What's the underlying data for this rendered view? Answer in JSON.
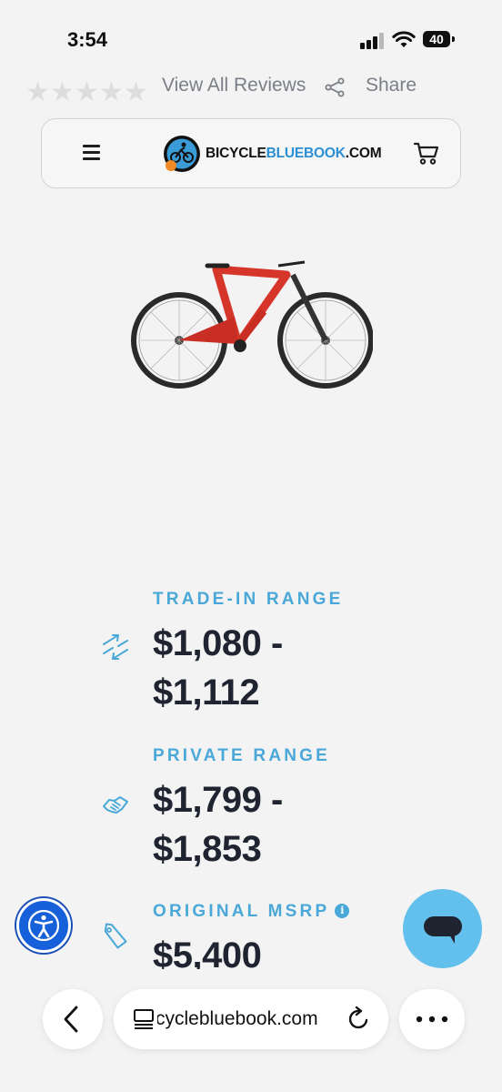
{
  "status_bar": {
    "time": "3:54",
    "battery": "40"
  },
  "reviews": {
    "star_count": 5,
    "filled_stars": 0,
    "view_all_label": "View All Reviews",
    "share_label": "Share"
  },
  "header": {
    "logo": {
      "part1": "BICYCLE",
      "part2": "BLUEBOOK",
      "part3": ".COM"
    }
  },
  "product_image": {
    "icon": "bike-image"
  },
  "pricing": {
    "trade_in": {
      "label": "TRADE-IN RANGE",
      "value_line1": "$1,080 -",
      "value_line2": "$1,112",
      "icon": "arrows-swap-icon"
    },
    "private": {
      "label": "PRIVATE RANGE",
      "value_line1": "$1,799 -",
      "value_line2": "$1,853",
      "icon": "handshake-icon"
    },
    "msrp": {
      "label": "ORIGINAL MSRP",
      "value": "$5,400",
      "icon": "price-tag-icon",
      "info_icon": "i"
    }
  },
  "browser": {
    "url": "cyclebluebook.com"
  },
  "colors": {
    "accent": "#4aa8d8",
    "chat_button": "#63c0ec",
    "accessibility": "#1660d9",
    "text": "#1f2430"
  }
}
